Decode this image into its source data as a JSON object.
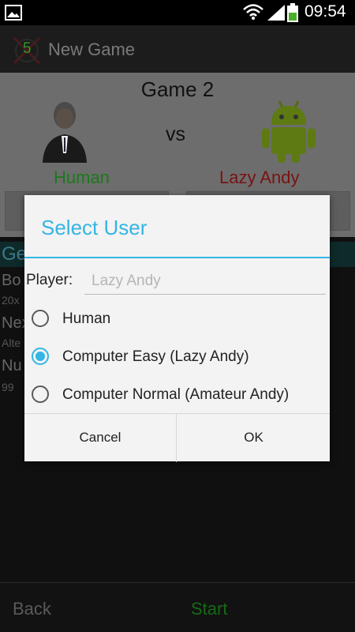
{
  "status_bar": {
    "time": "09:54",
    "icons": [
      "gallery-icon",
      "wifi-icon",
      "signal-icon",
      "battery-icon"
    ]
  },
  "action_bar": {
    "logo_number": "5",
    "title": "New Game"
  },
  "game": {
    "title": "Game 2",
    "vs": "vs",
    "player1": "Human",
    "player2": "Lazy Andy"
  },
  "settings": {
    "header": "Ge",
    "items": [
      {
        "label": "Bo",
        "value": "20x"
      },
      {
        "label": "Nex",
        "value": "Alte"
      },
      {
        "label": "Nu",
        "value": "99"
      }
    ]
  },
  "bottom_bar": {
    "back_label": "Back",
    "start_label": "Start"
  },
  "dialog": {
    "title": "Select User",
    "player_label": "Player:",
    "player_placeholder": "Lazy Andy",
    "options": [
      {
        "label": "Human",
        "checked": false
      },
      {
        "label": "Computer Easy (Lazy Andy)",
        "checked": true
      },
      {
        "label": "Computer Normal (Amateur Andy)",
        "checked": false
      }
    ],
    "cancel_label": "Cancel",
    "ok_label": "OK"
  },
  "colors": {
    "accent": "#33b5e5",
    "player1": "#1a7a1a",
    "player2": "#7a1212",
    "start": "#156b15"
  }
}
